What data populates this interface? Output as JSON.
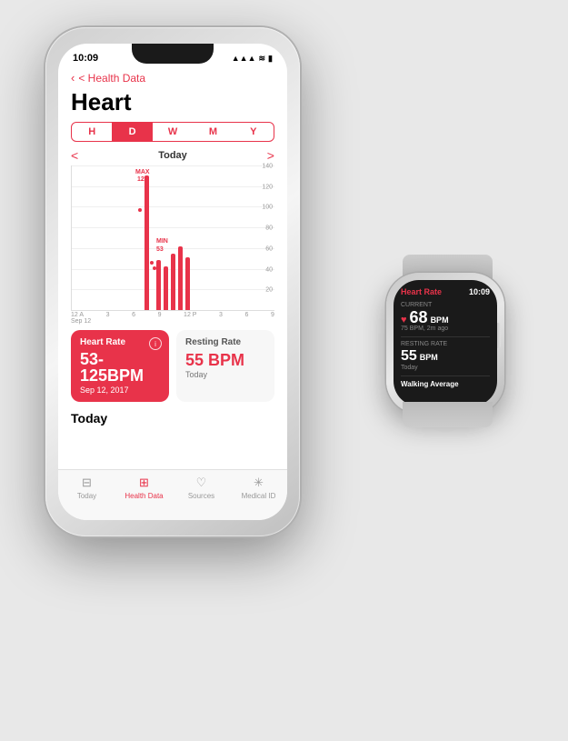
{
  "scene": {
    "background": "#e8e8e8"
  },
  "status_bar": {
    "time": "10:09",
    "signal": "●●●",
    "wifi": "WiFi",
    "battery": "🔋"
  },
  "back_nav": {
    "label": "< Health Data"
  },
  "page": {
    "title": "Heart"
  },
  "time_tabs": {
    "tabs": [
      "H",
      "D",
      "W",
      "M",
      "Y"
    ],
    "active": "D"
  },
  "chart_nav": {
    "left_arrow": "<",
    "label": "Today",
    "right_arrow": ">"
  },
  "chart": {
    "y_labels": [
      "140",
      "120",
      "100",
      "80",
      "60",
      "40",
      "20"
    ],
    "x_labels": [
      "12 A",
      "3",
      "6",
      "9",
      "12 P",
      "3",
      "6",
      "9"
    ],
    "x_sub": "Sep 12",
    "max_label": "MAX\n125",
    "min_label": "MIN\n53"
  },
  "heart_rate_card": {
    "title": "Heart Rate",
    "bpm": "53-125BPM",
    "date": "Sep 12, 2017",
    "info_icon": "i"
  },
  "resting_card": {
    "title": "Resting Rate",
    "bpm": "55 BPM",
    "sub": "Today"
  },
  "today_section": {
    "label": "Today"
  },
  "tab_bar": {
    "items": [
      {
        "label": "Today",
        "icon": "⊞",
        "active": false
      },
      {
        "label": "Health Data",
        "icon": "⊞",
        "active": true
      },
      {
        "label": "Sources",
        "icon": "♥",
        "active": false
      },
      {
        "label": "Medical ID",
        "icon": "✳",
        "active": false
      }
    ]
  },
  "watch": {
    "title": "Heart Rate",
    "time": "10:09",
    "current_label": "Current",
    "heart_icon": "♥",
    "current_bpm": "68",
    "current_unit": "BPM",
    "current_sub": "75 BPM, 2m ago",
    "resting_label": "Resting Rate",
    "resting_bpm": "55",
    "resting_unit": "BPM",
    "resting_sub": "Today",
    "walking_label": "Walking Average"
  }
}
